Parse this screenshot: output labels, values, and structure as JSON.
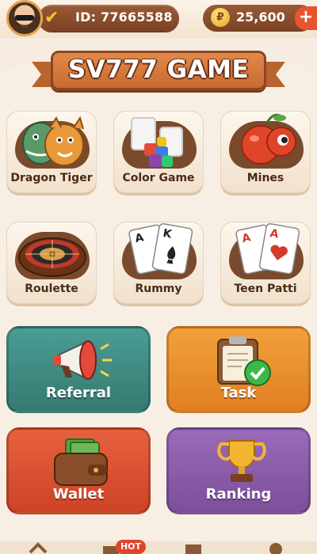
{
  "profile": {
    "id_text": "ID: 77665588"
  },
  "balance": {
    "coin_symbol": "₽",
    "amount": "25,600",
    "add_label": "+"
  },
  "title": "SV777 GAME",
  "games": [
    {
      "label": "Dragon Tiger",
      "icon": "dragon-tiger-icon"
    },
    {
      "label": "Color Game",
      "icon": "color-game-icon"
    },
    {
      "label": "Mines",
      "icon": "mines-icon"
    },
    {
      "label": "Roulette",
      "icon": "roulette-icon"
    },
    {
      "label": "Rummy",
      "icon": "rummy-icon"
    },
    {
      "label": "Teen Patti",
      "icon": "teen-patti-icon"
    }
  ],
  "actions": [
    {
      "label": "Referral",
      "icon": "megaphone-icon",
      "color": "#3f8b83"
    },
    {
      "label": "Task",
      "icon": "clipboard-check-icon",
      "color": "#e9892e"
    },
    {
      "label": "Wallet",
      "icon": "wallet-icon",
      "color": "#e0553a"
    },
    {
      "label": "Ranking",
      "icon": "trophy-icon",
      "color": "#8b5ba8"
    }
  ],
  "bottom_nav": {
    "hot_badge": "HOT"
  },
  "colors": {
    "background": "#f6ece1",
    "brown": "#7a4224",
    "accent": "#e8542f"
  }
}
